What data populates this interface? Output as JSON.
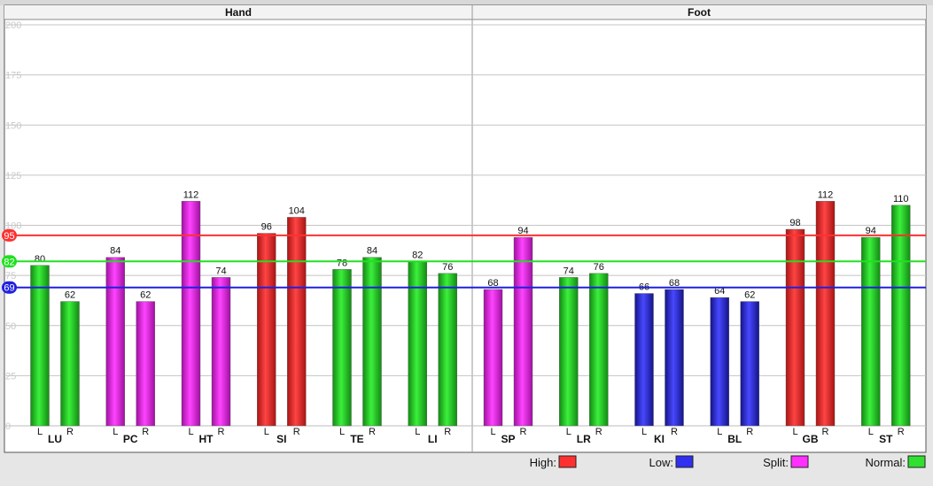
{
  "chart_data": {
    "type": "bar",
    "panels": [
      {
        "title": "Hand",
        "groups": [
          "LU",
          "PC",
          "HT",
          "SI",
          "TE",
          "LI"
        ]
      },
      {
        "title": "Foot",
        "groups": [
          "SP",
          "LR",
          "KI",
          "BL",
          "GB",
          "ST"
        ]
      }
    ],
    "sub_labels": [
      "L",
      "R"
    ],
    "ylim": [
      0,
      200
    ],
    "yticks": [
      0,
      25,
      50,
      75,
      100,
      125,
      150,
      175,
      200
    ],
    "ytick_labels": [
      "0",
      "25",
      "50",
      "75",
      "100",
      "125",
      "150",
      "175",
      "200"
    ],
    "grid": true,
    "bars": [
      {
        "group": "LU",
        "side": "L",
        "value": 80,
        "label": "80",
        "category": "normal"
      },
      {
        "group": "LU",
        "side": "R",
        "value": 62,
        "label": "62",
        "category": "normal"
      },
      {
        "group": "PC",
        "side": "L",
        "value": 84,
        "label": "84",
        "category": "split"
      },
      {
        "group": "PC",
        "side": "R",
        "value": 62,
        "label": "62",
        "category": "split"
      },
      {
        "group": "HT",
        "side": "L",
        "value": 112,
        "label": "112",
        "category": "split"
      },
      {
        "group": "HT",
        "side": "R",
        "value": 74,
        "label": "74",
        "category": "split"
      },
      {
        "group": "SI",
        "side": "L",
        "value": 96,
        "label": "96",
        "category": "high"
      },
      {
        "group": "SI",
        "side": "R",
        "value": 104,
        "label": "104",
        "category": "high"
      },
      {
        "group": "TE",
        "side": "L",
        "value": 78,
        "label": "78",
        "category": "normal"
      },
      {
        "group": "TE",
        "side": "R",
        "value": 84,
        "label": "84",
        "category": "normal"
      },
      {
        "group": "LI",
        "side": "L",
        "value": 82,
        "label": "82",
        "category": "normal"
      },
      {
        "group": "LI",
        "side": "R",
        "value": 76,
        "label": "76",
        "category": "normal"
      },
      {
        "group": "SP",
        "side": "L",
        "value": 68,
        "label": "68",
        "category": "split"
      },
      {
        "group": "SP",
        "side": "R",
        "value": 94,
        "label": "94",
        "category": "split"
      },
      {
        "group": "LR",
        "side": "L",
        "value": 74,
        "label": "74",
        "category": "normal"
      },
      {
        "group": "LR",
        "side": "R",
        "value": 76,
        "label": "76",
        "category": "normal"
      },
      {
        "group": "KI",
        "side": "L",
        "value": 66,
        "label": "66",
        "category": "low"
      },
      {
        "group": "KI",
        "side": "R",
        "value": 68,
        "label": "68",
        "category": "low"
      },
      {
        "group": "BL",
        "side": "L",
        "value": 64,
        "label": "64",
        "category": "low"
      },
      {
        "group": "BL",
        "side": "R",
        "value": 62,
        "label": "62",
        "category": "low"
      },
      {
        "group": "GB",
        "side": "L",
        "value": 98,
        "label": "98",
        "category": "high"
      },
      {
        "group": "GB",
        "side": "R",
        "value": 112,
        "label": "112",
        "category": "high"
      },
      {
        "group": "ST",
        "side": "L",
        "value": 94,
        "label": "94",
        "category": "normal"
      },
      {
        "group": "ST",
        "side": "R",
        "value": 110,
        "label": "110",
        "category": "normal"
      }
    ],
    "reference_lines": [
      {
        "value": 95,
        "label": "95",
        "color": "#ff3030"
      },
      {
        "value": 82,
        "label": "82",
        "color": "#20e020"
      },
      {
        "value": 69,
        "label": "69",
        "color": "#2020e0"
      }
    ],
    "legend": [
      {
        "label": "High:",
        "category": "high"
      },
      {
        "label": "Low:",
        "category": "low"
      },
      {
        "label": "Split:",
        "category": "split"
      },
      {
        "label": "Normal:",
        "category": "normal"
      }
    ],
    "legend_placement": "bottom",
    "colors": {
      "high": "#ff3030",
      "low": "#3030f0",
      "split": "#ff30ff",
      "normal": "#30e030"
    }
  }
}
